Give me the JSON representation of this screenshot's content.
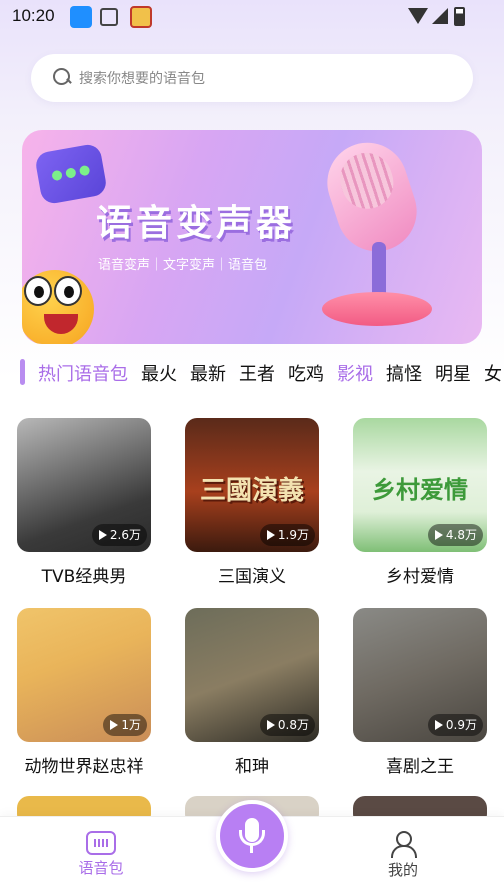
{
  "status_bar": {
    "time": "10:20"
  },
  "search": {
    "placeholder": "搜索你想要的语音包"
  },
  "banner": {
    "title": "语音变声器",
    "subtitle": "语音变声｜文字变声｜语音包"
  },
  "tabs": [
    "热门语音包",
    "最火",
    "最新",
    "王者",
    "吃鸡",
    "影视",
    "搞怪",
    "明星",
    "女"
  ],
  "active_tab": "热门语音包",
  "packs": [
    {
      "title": "TVB经典男",
      "count": "2.6万"
    },
    {
      "title": "三国演义",
      "count": "1.9万",
      "thumb_text": "三國演義"
    },
    {
      "title": "乡村爱情",
      "count": "4.8万",
      "thumb_text": "乡村爱情"
    },
    {
      "title": "动物世界赵忠祥",
      "count": "1万"
    },
    {
      "title": "和珅",
      "count": "0.8万"
    },
    {
      "title": "喜剧之王",
      "count": "0.9万"
    }
  ],
  "bottom_nav": {
    "voice_pack": "语音包",
    "mine": "我的"
  },
  "colors": {
    "accent": "#a96de8",
    "fab": "#b87ff3"
  }
}
